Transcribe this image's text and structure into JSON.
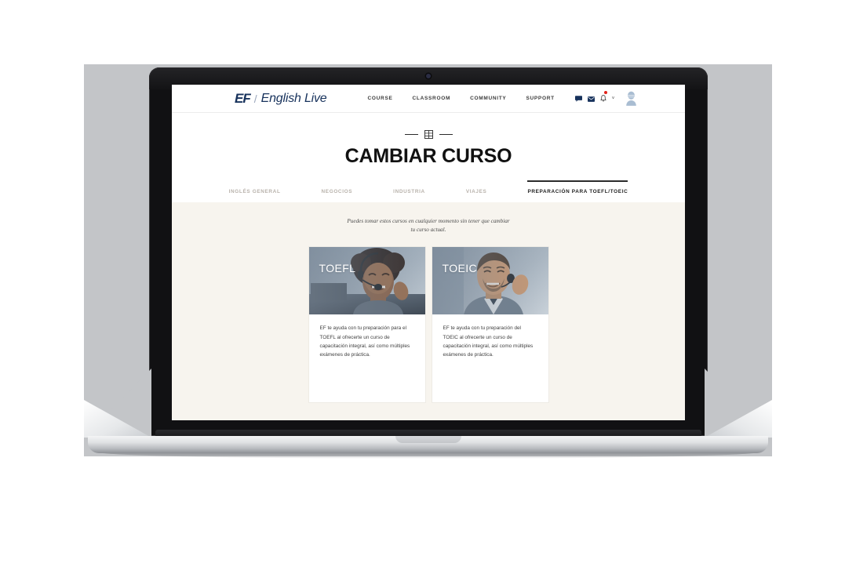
{
  "site": {
    "logo": {
      "mark": "EF",
      "divider": "/",
      "wordmark": "English Live"
    },
    "nav": [
      {
        "label": "COURSE",
        "name": "nav-course"
      },
      {
        "label": "CLASSROOM",
        "name": "nav-classroom"
      },
      {
        "label": "COMMUNITY",
        "name": "nav-community"
      },
      {
        "label": "SUPPORT",
        "name": "nav-support"
      }
    ],
    "icons": {
      "chat": "chat-bubble-icon",
      "mail": "envelope-icon",
      "bell": "bell-icon",
      "bell_badge": true,
      "caret": "˅",
      "avatar": "user-avatar-placeholder"
    }
  },
  "hero": {
    "ornament_icon": "grid-window-icon",
    "title": "CAMBIAR CURSO"
  },
  "tabs": [
    {
      "label": "INGLÉS GENERAL",
      "active": false
    },
    {
      "label": "NEGOCIOS",
      "active": false
    },
    {
      "label": "INDUSTRIA",
      "active": false
    },
    {
      "label": "VIAJES",
      "active": false
    },
    {
      "label": "PREPARACIÓN PARA TOEFL/TOEIC",
      "active": true
    }
  ],
  "content": {
    "subtitle": "Puedes tomar estos cursos en cualquier momento sin tener que cambiar tu curso actual.",
    "cards": [
      {
        "label": "TOEFL",
        "description": "EF te ayuda con tu preparación para el TOEFL al ofrecerte un curso de capacitación integral, así como múltiples exámenes de práctica.",
        "image_alt": "smiling-woman-with-headset"
      },
      {
        "label": "TOEIC",
        "description": "EF te ayuda con tu preparación del TOEIC al ofrecerte un curso de capacitación integral, así como múltiples exámenes de práctica.",
        "image_alt": "smiling-man-with-headset"
      }
    ]
  },
  "colors": {
    "brand_navy": "#17325c",
    "page_cream": "#f7f4ee",
    "tab_inactive": "#b8b2ab",
    "tab_active": "#1d1d1d",
    "badge_red": "#e2231a"
  }
}
